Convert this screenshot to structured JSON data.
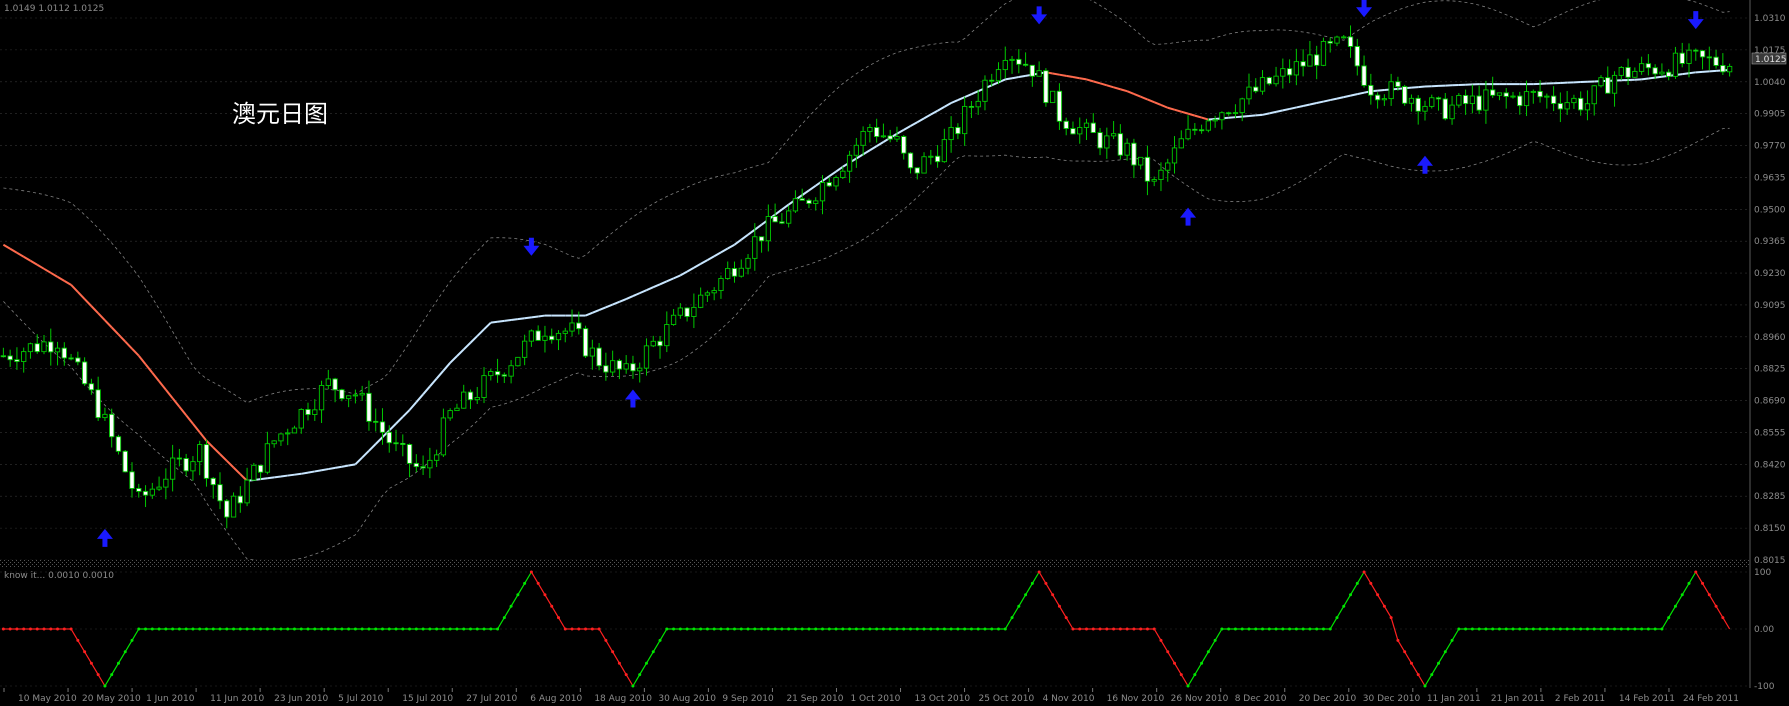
{
  "window": {
    "ohlc_readout": "1.0149 1.0112 1.0125",
    "indicator_readout": "know it... 0.0010 0.0010",
    "current_price_label": "1.0125"
  },
  "chart_data": [
    {
      "type": "candlestick",
      "title": "澳元日图",
      "ylim": [
        0.8015,
        1.031
      ],
      "y_ticks": [
        "1.0310",
        "1.0175",
        "1.0040",
        "0.9905",
        "0.9770",
        "0.9635",
        "0.9500",
        "0.9365",
        "0.9230",
        "0.9095",
        "0.8960",
        "0.8825",
        "0.8690",
        "0.8555",
        "0.8420",
        "0.8285",
        "0.8150",
        "0.8015"
      ],
      "x_ticks": [
        "10 May 2010",
        "20 May 2010",
        "1 Jun 2010",
        "11 Jun 2010",
        "23 Jun 2010",
        "5 Jul 2010",
        "15 Jul 2010",
        "27 Jul 2010",
        "6 Aug 2010",
        "18 Aug 2010",
        "30 Aug 2010",
        "9 Sep 2010",
        "21 Sep 2010",
        "1 Oct 2010",
        "13 Oct 2010",
        "25 Oct 2010",
        "4 Nov 2010",
        "16 Nov 2010",
        "26 Nov 2010",
        "8 Dec 2010",
        "20 Dec 2010",
        "30 Dec 2010",
        "11 Jan 2011",
        "21 Jan 2011",
        "2 Feb 2011",
        "14 Feb 2011",
        "24 Feb 2011"
      ],
      "close_path": [
        [
          0,
          0.888
        ],
        [
          8,
          0.895
        ],
        [
          14,
          0.866
        ],
        [
          20,
          0.826
        ],
        [
          24,
          0.838
        ],
        [
          29,
          0.848
        ],
        [
          33,
          0.82
        ],
        [
          40,
          0.852
        ],
        [
          48,
          0.876
        ],
        [
          52,
          0.872
        ],
        [
          58,
          0.848
        ],
        [
          62,
          0.838
        ],
        [
          66,
          0.863
        ],
        [
          72,
          0.878
        ],
        [
          80,
          0.9
        ],
        [
          84,
          0.898
        ],
        [
          88,
          0.886
        ],
        [
          92,
          0.88
        ],
        [
          96,
          0.893
        ],
        [
          102,
          0.91
        ],
        [
          106,
          0.92
        ],
        [
          112,
          0.94
        ],
        [
          118,
          0.952
        ],
        [
          124,
          0.97
        ],
        [
          128,
          0.985
        ],
        [
          132,
          0.978
        ],
        [
          134,
          0.965
        ],
        [
          140,
          0.98
        ],
        [
          144,
          0.999
        ],
        [
          148,
          1.018
        ],
        [
          152,
          1.01
        ],
        [
          156,
          0.99
        ],
        [
          160,
          0.982
        ],
        [
          166,
          0.975
        ],
        [
          170,
          0.96
        ],
        [
          174,
          0.978
        ],
        [
          178,
          0.99
        ],
        [
          182,
          0.995
        ],
        [
          188,
          1.005
        ],
        [
          194,
          1.015
        ],
        [
          198,
          1.02
        ],
        [
          202,
          1.002
        ],
        [
          208,
          0.998
        ],
        [
          212,
          0.992
        ],
        [
          218,
          0.996
        ],
        [
          226,
          0.998
        ],
        [
          234,
          0.995
        ],
        [
          238,
          1.007
        ],
        [
          244,
          1.01
        ],
        [
          250,
          1.013
        ],
        [
          255,
          1.012
        ]
      ],
      "ma_path": [
        [
          0,
          0.935
        ],
        [
          10,
          0.918
        ],
        [
          20,
          0.888
        ],
        [
          30,
          0.852
        ],
        [
          36,
          0.835
        ],
        [
          44,
          0.838
        ],
        [
          52,
          0.842
        ],
        [
          60,
          0.865
        ],
        [
          66,
          0.885
        ],
        [
          72,
          0.902
        ],
        [
          80,
          0.905
        ],
        [
          86,
          0.905
        ],
        [
          92,
          0.912
        ],
        [
          100,
          0.922
        ],
        [
          108,
          0.935
        ],
        [
          116,
          0.952
        ],
        [
          124,
          0.968
        ],
        [
          132,
          0.982
        ],
        [
          140,
          0.995
        ],
        [
          148,
          1.005
        ],
        [
          154,
          1.008
        ],
        [
          160,
          1.005
        ],
        [
          166,
          1.0
        ],
        [
          172,
          0.993
        ],
        [
          178,
          0.988
        ],
        [
          186,
          0.99
        ],
        [
          194,
          0.995
        ],
        [
          202,
          1.0
        ],
        [
          210,
          1.002
        ],
        [
          218,
          1.003
        ],
        [
          226,
          1.003
        ],
        [
          234,
          1.004
        ],
        [
          242,
          1.005
        ],
        [
          250,
          1.008
        ],
        [
          255,
          1.009
        ]
      ],
      "band_width": 0.03,
      "candle_count": 256,
      "down_arrows": [
        {
          "i": 78,
          "p": 0.932
        },
        {
          "i": 153,
          "p": 1.03
        },
        {
          "i": 201,
          "p": 1.033
        },
        {
          "i": 250,
          "p": 1.028
        }
      ],
      "up_arrows": [
        {
          "i": 15,
          "p": 0.813
        },
        {
          "i": 93,
          "p": 0.872
        },
        {
          "i": 175,
          "p": 0.949
        },
        {
          "i": 210,
          "p": 0.971
        }
      ],
      "ma_colors": {
        "falling": "#ff6a4d",
        "rising": "#c8e6ff"
      },
      "candle_color": "#00c800",
      "band_color": "#808080"
    },
    {
      "type": "line",
      "name": "indicator",
      "ylim": [
        -100,
        100
      ],
      "y_ticks": [
        "100",
        "0.00",
        "-100"
      ],
      "pattern": "cyclic",
      "colors": {
        "up": "#00e600",
        "down": "#ff2020"
      }
    }
  ],
  "colors": {
    "background": "#000000",
    "grid": "#404040",
    "text": "#8c8c8c"
  }
}
